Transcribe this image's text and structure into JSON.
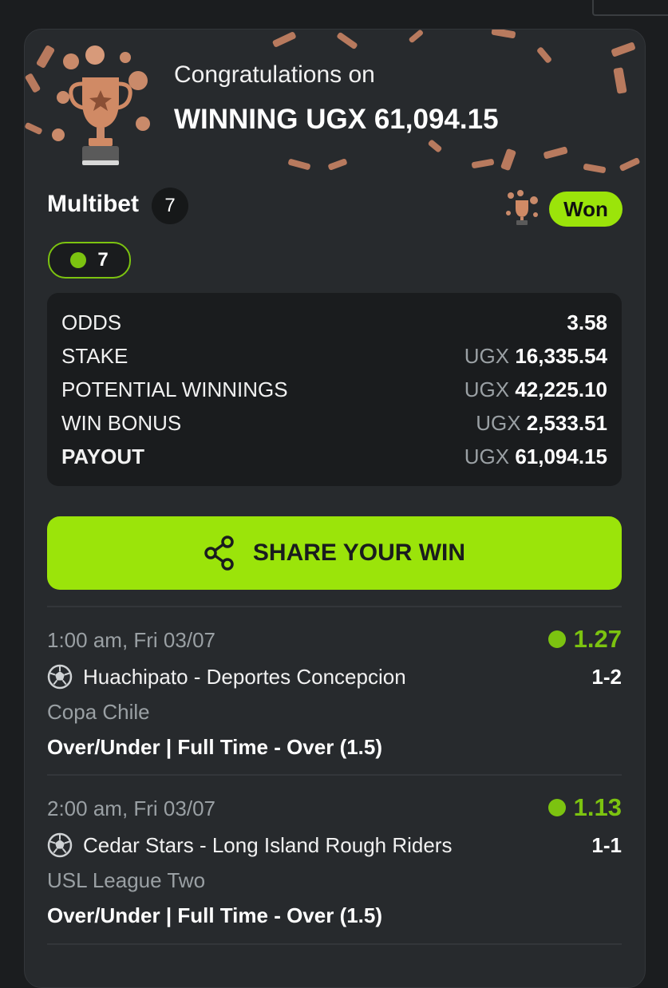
{
  "header": {
    "congrats_text": "Congratulations on",
    "winning_text": "WINNING UGX 61,094.15"
  },
  "bet_summary": {
    "title": "Multibet",
    "selection_count": "7",
    "status": "Won",
    "won_selections": "7",
    "rows": [
      {
        "label": "ODDS",
        "currency": "",
        "amount": "3.58"
      },
      {
        "label": "STAKE",
        "currency": "UGX",
        "amount": "16,335.54"
      },
      {
        "label": "POTENTIAL WINNINGS",
        "currency": "UGX",
        "amount": "42,225.10"
      },
      {
        "label": "WIN BONUS",
        "currency": "UGX",
        "amount": "2,533.51"
      },
      {
        "label": "PAYOUT",
        "currency": "UGX",
        "amount": "61,094.15"
      }
    ]
  },
  "share_button": {
    "label": "SHARE YOUR WIN"
  },
  "bets": [
    {
      "time": "1:00 am, Fri 03/07",
      "odds": "1.27",
      "teams": "Huachipato - Deportes Concepcion",
      "score": "1-2",
      "league": "Copa Chile",
      "market": "Over/Under | Full Time - Over (1.5)"
    },
    {
      "time": "2:00 am, Fri 03/07",
      "odds": "1.13",
      "teams": "Cedar Stars - Long Island Rough Riders",
      "score": "1-1",
      "league": "USL League Two",
      "market": "Over/Under | Full Time - Over (1.5)"
    }
  ],
  "colors": {
    "accent": "#9be40a",
    "won_green": "#7cc310",
    "card_bg": "#272a2d",
    "summary_bg": "#1a1c1e",
    "confetti": "#c98a6a"
  },
  "icons": {
    "trophy": "trophy-icon",
    "share": "share-icon",
    "ball": "soccer-ball-icon",
    "status_dot": "status-dot-icon"
  }
}
